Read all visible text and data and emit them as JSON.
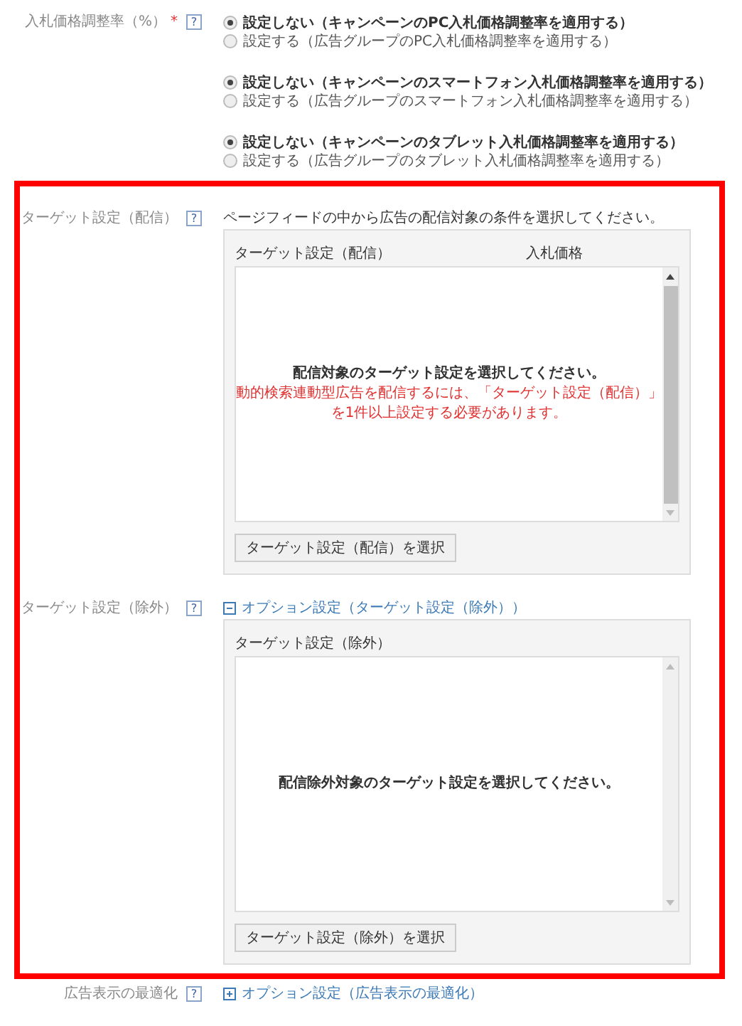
{
  "bid_adjustment": {
    "label": "入札価格調整率（%）",
    "required_mark": "*",
    "help": "?",
    "groups": [
      {
        "options": [
          {
            "label": "設定しない（キャンペーンのPC入札価格調整率を適用する）",
            "selected": true
          },
          {
            "label": "設定する（広告グループのPC入札価格調整率を適用する）",
            "selected": false
          }
        ]
      },
      {
        "options": [
          {
            "label": "設定しない（キャンペーンのスマートフォン入札価格調整率を適用する）",
            "selected": true
          },
          {
            "label": "設定する（広告グループのスマートフォン入札価格調整率を適用する）",
            "selected": false
          }
        ]
      },
      {
        "options": [
          {
            "label": "設定しない（キャンペーンのタブレット入札価格調整率を適用する）",
            "selected": true
          },
          {
            "label": "設定する（広告グループのタブレット入札価格調整率を適用する）",
            "selected": false
          }
        ]
      }
    ]
  },
  "highlighted_section": {
    "rows": [
      {
        "label": "ターゲット設定（配信）",
        "help": "?",
        "description": "ページフィードの中から広告の配信対象の条件を選択してください。",
        "panel": {
          "columns": [
            "ターゲット設定（配信）",
            "入札価格"
          ],
          "empty_message": "配信対象のターゲット設定を選択してください。",
          "warning": [
            "動的検索連動型広告を配信するには、「ターゲット設定（配信）」",
            "を1件以上設定する必要があります。"
          ],
          "button": "ターゲット設定（配信）を選択"
        }
      },
      {
        "label": "ターゲット設定（除外）",
        "help": "?",
        "toggle": {
          "expanded": true,
          "label": "オプション設定（ターゲット設定（除外））"
        },
        "panel": {
          "columns": [
            "ターゲット設定（除外）"
          ],
          "empty_message": "配信除外対象のターゲット設定を選択してください。",
          "button": "ターゲット設定（除外）を選択"
        }
      }
    ]
  },
  "ad_optimization": {
    "label": "広告表示の最適化",
    "help": "?",
    "toggle": {
      "expanded": false,
      "label": "オプション設定（広告表示の最適化）"
    }
  }
}
